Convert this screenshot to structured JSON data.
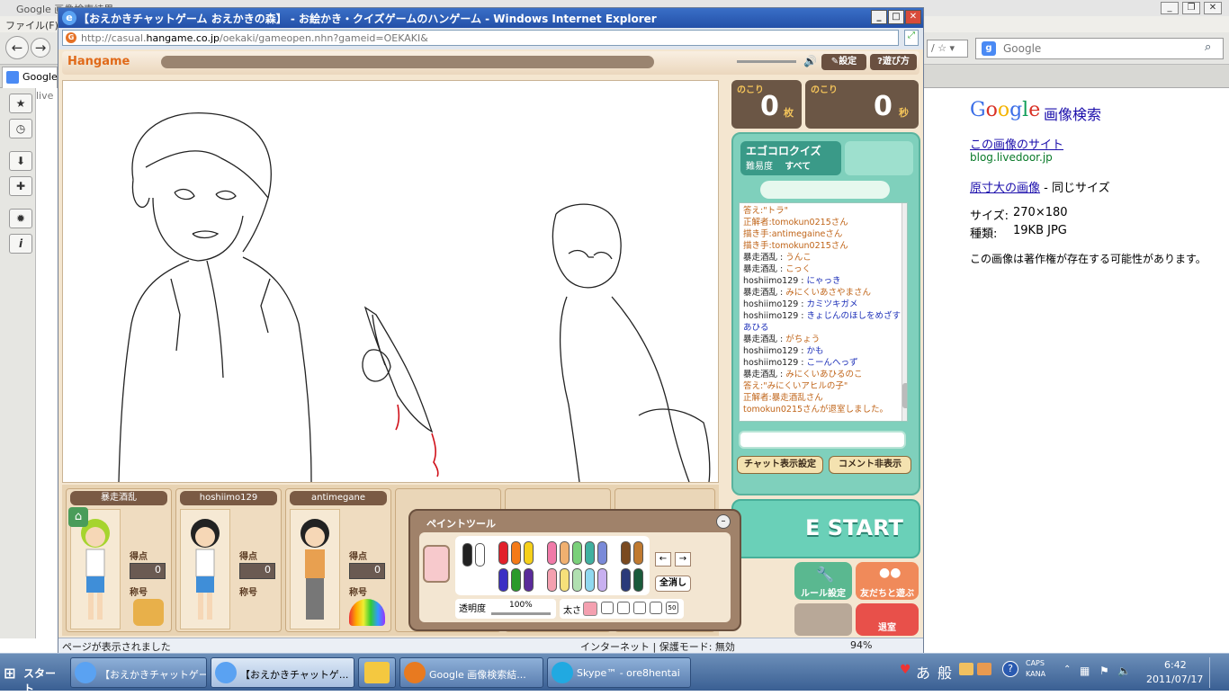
{
  "firefox": {
    "title": "Google 画像検索結果",
    "menu_file": "ファイル(F)",
    "tab_label": "Google",
    "search_placeholder": "Google",
    "sidebar_fragment": "live"
  },
  "google_panel": {
    "brand": "Google",
    "section": "画像検索",
    "site_link": "この画像のサイト",
    "site_url": "blog.livedoor.jp",
    "fullsize_link": "原寸大の画像",
    "fullsize_suffix": " - 同じサイズ",
    "size_label": "サイズ:",
    "size_value": "270×180",
    "type_label": "種類:",
    "type_value": "19KB JPG",
    "copyright_note": "この画像は著作権が存在する可能性があります。"
  },
  "ie": {
    "title": "【おえかきチャットゲーム おえかきの森】 - お絵かき・クイズゲームのハンゲーム - Windows Internet Explorer",
    "address_prefix": "http://casual.",
    "address_bold": "hangame.co.jp",
    "address_rest": "/oekaki/gameopen.nhn?gameid=OEKAKI&",
    "status_text": "ページが表示されました",
    "zone_text": "インターネット | 保護モード: 無効",
    "zoom": "94%"
  },
  "game": {
    "logo": "Hangame",
    "settings_btn": "設定",
    "howto_btn": "遊び方",
    "remaining_left_label": "のこり",
    "remaining_left_value": "0",
    "remaining_left_unit": "枚",
    "remaining_right_label": "のこり",
    "remaining_right_value": "0",
    "remaining_right_unit": "秒",
    "quiz_title": "エゴコロクイズ",
    "difficulty_label": "難易度",
    "difficulty_value": "すべて",
    "chat_settings_btn": "チャット表示設定",
    "comment_hide_btn": "コメント非表示",
    "start_label": "E START",
    "rule_btn": "ルール設定",
    "friends_btn": "友だちと遊ぶ",
    "leave_btn": "退室",
    "score_label": "得点",
    "title_label": "称号"
  },
  "chat_lines": [
    {
      "name": "答え:",
      "msg": "\"トラ\"",
      "type": "sys"
    },
    {
      "name": "正解者:",
      "msg": "tomokun0215さん",
      "type": "sys"
    },
    {
      "name": "描き手:",
      "msg": "antimegaineさん",
      "type": "sys"
    },
    {
      "name": "描き手:",
      "msg": "tomokun0215さん",
      "type": "sys"
    },
    {
      "name": "暴走酒乱 : ",
      "msg": "うんこ",
      "type": "o"
    },
    {
      "name": "暴走酒乱 : ",
      "msg": "こっく",
      "type": "o"
    },
    {
      "name": "hoshiimo129 : ",
      "msg": "にゃっき",
      "type": "b"
    },
    {
      "name": "暴走酒乱 : ",
      "msg": "みにくいあさやまさん",
      "type": "o"
    },
    {
      "name": "hoshiimo129 : ",
      "msg": "カミツキガメ",
      "type": "b"
    },
    {
      "name": "hoshiimo129 : ",
      "msg": "きょじんのほしをめざすあひる",
      "type": "b"
    },
    {
      "name": "暴走酒乱 : ",
      "msg": "がちょう",
      "type": "o"
    },
    {
      "name": "hoshiimo129 : ",
      "msg": "かも",
      "type": "b"
    },
    {
      "name": "hoshiimo129 : ",
      "msg": "こーんへっず",
      "type": "b"
    },
    {
      "name": "暴走酒乱 : ",
      "msg": "みにくいあひるのこ",
      "type": "o"
    },
    {
      "name": "答え:",
      "msg": "\"みにくいアヒルの子\"",
      "type": "sys"
    },
    {
      "name": "正解者:",
      "msg": "暴走酒乱さん",
      "type": "sys"
    },
    {
      "name": "",
      "msg": "tomokun0215さんが退室しました。",
      "type": "sys"
    }
  ],
  "players": [
    {
      "name": "暴走酒乱",
      "score": "0"
    },
    {
      "name": "hoshiimo129",
      "score": "0"
    },
    {
      "name": "antimegane",
      "score": "0"
    }
  ],
  "paint_tool": {
    "title": "ペイントツール",
    "opacity_label": "透明度",
    "opacity_value": "100%",
    "size_label": "太さ",
    "clear_btn": "全消し",
    "size_max": "50"
  },
  "taskbar": {
    "start": "スタート",
    "task1": "【おえかきチャットゲーム...",
    "task2": "【おえかきチャットゲ...",
    "task4": "Google 画像検索結...",
    "task5": "Skype™ - ore8hentai",
    "ime1": "あ",
    "ime2": "般",
    "caps": "CAPS",
    "kana": "KANA",
    "time": "6:42",
    "date": "2011/07/17"
  },
  "colors": {
    "accent_teal": "#7fd0bc",
    "ie_title": "#2f60b8",
    "taskbar": "#4a6fa3"
  }
}
